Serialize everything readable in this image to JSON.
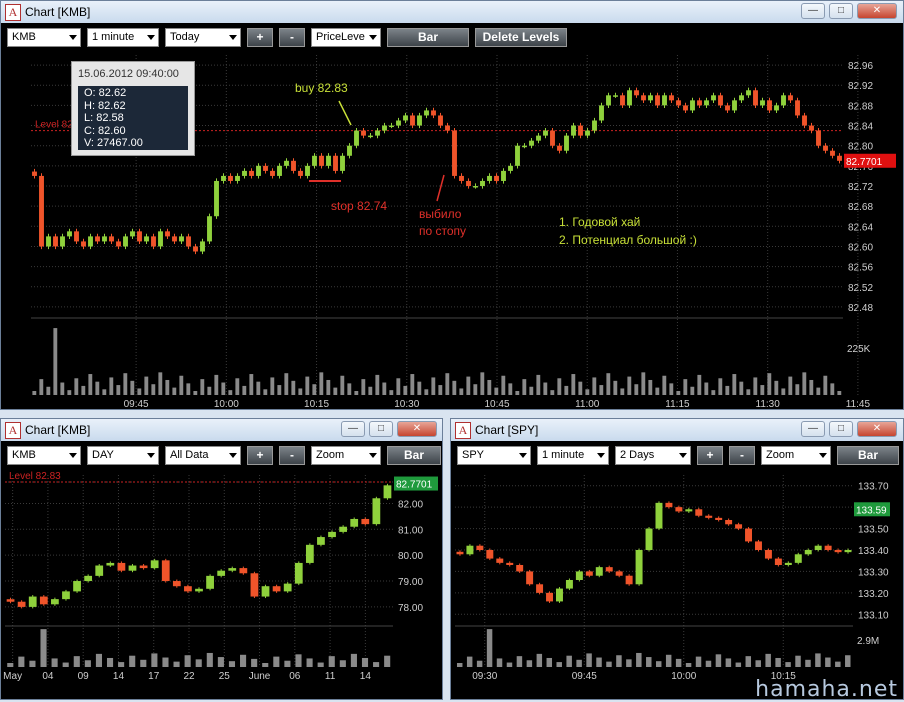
{
  "colors": {
    "up": "#8fd13c",
    "down": "#f0542a",
    "grid": "#3a3a3a",
    "axis": "#cfcfcf",
    "level": "#cc2222",
    "price_tag": "#e01010",
    "price_tag_green": "#1f9a3c",
    "annot_yellow": "#c8e038",
    "annot_red": "#e0302a",
    "volume": "#8a8a8a"
  },
  "main": {
    "title": "Chart [KMB]",
    "logo": "A",
    "window_buttons": {
      "minimize": "minimize-icon",
      "maximize": "maximize-icon",
      "close": "close-icon"
    },
    "toolbar": {
      "symbol": "KMB",
      "interval": "1 minute",
      "range": "Today",
      "plus": "+",
      "minus": "-",
      "tool": "PriceLeve",
      "bar_label": "Bar",
      "delete_label": "Delete Levels"
    },
    "level_label": "Level 82.83",
    "last_price": "82.7701",
    "tooltip": {
      "datetime": "15.06.2012 09:40:00",
      "o": "O: 82.62",
      "h": "H: 82.62",
      "l": "L: 82.58",
      "c": "C: 82.60",
      "v": "V: 27467.00"
    },
    "annotations": {
      "buy": "buy 82.83",
      "stop": "stop 82.74",
      "hit1": "выбило",
      "hit2": "по стопу",
      "note1": "1. Годовой хай",
      "note2": "2. Потенциал большой :)"
    },
    "volume_label": "225K"
  },
  "kmb_daily": {
    "title": "Chart [KMB]",
    "logo": "A",
    "toolbar": {
      "symbol": "KMB",
      "interval": "DAY",
      "range": "All Data",
      "plus": "+",
      "minus": "-",
      "tool": "Zoom",
      "bar_label": "Bar"
    },
    "level_label": "Level 82.83",
    "last_price": "82.7701"
  },
  "spy": {
    "title": "Chart [SPY]",
    "logo": "A",
    "toolbar": {
      "symbol": "SPY",
      "interval": "1 minute",
      "range": "2 Days",
      "plus": "+",
      "minus": "-",
      "tool": "Zoom",
      "bar_label": "Bar"
    },
    "last_price": "133.59",
    "volume_label": "2.9M"
  },
  "watermark": "hamaha.net",
  "chart_data": [
    {
      "name": "KMB intraday",
      "type": "candlestick",
      "title": "Chart [KMB]",
      "x": [
        "09:45",
        "10:00",
        "10:15",
        "10:30",
        "10:45",
        "11:00",
        "11:15",
        "11:30",
        "11:45"
      ],
      "y_ticks": [
        82.48,
        82.52,
        82.56,
        82.6,
        82.64,
        82.68,
        82.72,
        82.76,
        82.8,
        82.84,
        82.88,
        82.92,
        82.96
      ],
      "ylim": [
        82.46,
        82.98
      ],
      "level": 82.83,
      "last": 82.7701,
      "closes": [
        82.74,
        82.6,
        82.62,
        82.6,
        82.62,
        82.63,
        82.61,
        82.6,
        82.62,
        82.61,
        82.62,
        82.61,
        82.6,
        82.62,
        82.63,
        82.61,
        82.62,
        82.6,
        82.63,
        82.62,
        82.61,
        82.62,
        82.6,
        82.59,
        82.61,
        82.66,
        82.73,
        82.74,
        82.73,
        82.74,
        82.75,
        82.74,
        82.76,
        82.75,
        82.74,
        82.76,
        82.77,
        82.75,
        82.74,
        82.76,
        82.78,
        82.76,
        82.78,
        82.75,
        82.78,
        82.8,
        82.83,
        82.82,
        82.82,
        82.83,
        82.84,
        82.84,
        82.85,
        82.86,
        82.84,
        82.86,
        82.87,
        82.86,
        82.84,
        82.83,
        82.74,
        82.73,
        82.72,
        82.72,
        82.73,
        82.74,
        82.73,
        82.75,
        82.76,
        82.8,
        82.8,
        82.81,
        82.82,
        82.83,
        82.8,
        82.79,
        82.82,
        82.84,
        82.82,
        82.83,
        82.85,
        82.88,
        82.9,
        82.9,
        82.88,
        82.91,
        82.9,
        82.89,
        82.9,
        82.88,
        82.9,
        82.89,
        82.88,
        82.87,
        82.89,
        82.88,
        82.89,
        82.9,
        82.88,
        82.87,
        82.89,
        82.9,
        82.91,
        82.88,
        82.89,
        82.87,
        82.88,
        82.9,
        82.89,
        82.86,
        82.84,
        82.83,
        82.8,
        82.79,
        82.78,
        82.77
      ],
      "volume_ylim": [
        0,
        300000
      ],
      "volume_tick": "225K"
    },
    {
      "name": "KMB daily",
      "type": "candlestick",
      "title": "Chart [KMB]",
      "x": [
        "May",
        "04",
        "09",
        "14",
        "17",
        "22",
        "25",
        "June",
        "06",
        "11",
        "14"
      ],
      "y_ticks": [
        78.0,
        79.0,
        80.0,
        81.0,
        82.0,
        82.83
      ],
      "ylim": [
        77.3,
        83.1
      ],
      "level": 82.83,
      "last": 82.7701,
      "closes": [
        78.2,
        78.0,
        78.4,
        78.1,
        78.3,
        78.6,
        79.0,
        79.2,
        79.6,
        79.7,
        79.4,
        79.6,
        79.5,
        79.8,
        79.0,
        78.8,
        78.6,
        78.7,
        79.2,
        79.4,
        79.5,
        79.3,
        78.4,
        78.8,
        78.6,
        78.9,
        79.7,
        80.4,
        80.7,
        80.9,
        81.1,
        81.4,
        81.2,
        82.2,
        82.7
      ]
    },
    {
      "name": "SPY intraday",
      "type": "candlestick",
      "title": "Chart [SPY]",
      "x": [
        "09:30",
        "09:45",
        "10:00",
        "10:15"
      ],
      "y_ticks": [
        133.1,
        133.2,
        133.3,
        133.4,
        133.5,
        133.6,
        133.7
      ],
      "ylim": [
        133.05,
        133.75
      ],
      "last": 133.59,
      "closes": [
        133.38,
        133.42,
        133.4,
        133.36,
        133.34,
        133.33,
        133.3,
        133.24,
        133.2,
        133.16,
        133.22,
        133.26,
        133.3,
        133.28,
        133.32,
        133.3,
        133.28,
        133.24,
        133.4,
        133.5,
        133.62,
        133.6,
        133.58,
        133.59,
        133.56,
        133.55,
        133.54,
        133.52,
        133.5,
        133.44,
        133.4,
        133.36,
        133.33,
        133.34,
        133.38,
        133.4,
        133.42,
        133.4,
        133.39,
        133.4
      ],
      "volume_tick": "2.9M"
    }
  ]
}
